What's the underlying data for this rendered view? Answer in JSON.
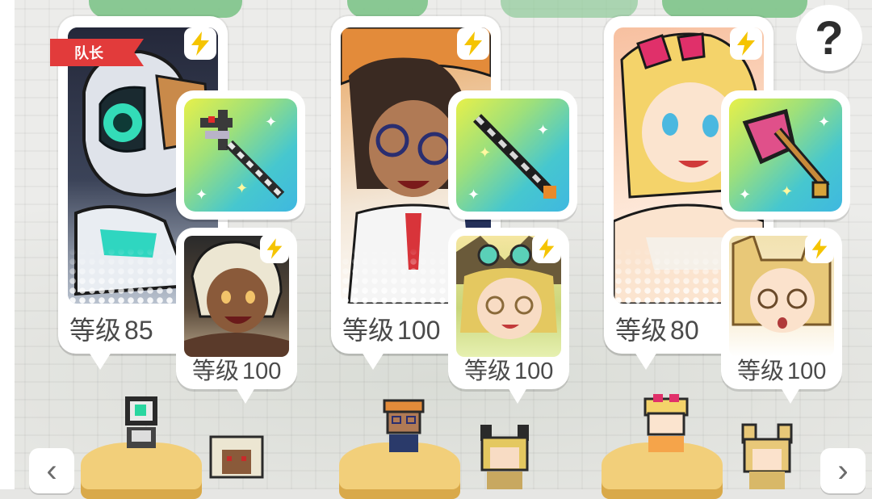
{
  "party": {
    "leader_label": "队长",
    "slots": [
      {
        "level_label": "等级",
        "level": "85",
        "support_level_label": "等级",
        "support_level": "100"
      },
      {
        "level_label": "等级",
        "level": "100",
        "support_level_label": "等级",
        "support_level": "100"
      },
      {
        "level_label": "等级",
        "level": "80",
        "support_level_label": "等级",
        "support_level": "100"
      }
    ]
  },
  "help_button": {
    "label": "?"
  },
  "nav": {
    "prev_icon": "‹",
    "next_icon": "›"
  },
  "icons": {
    "bolt": "lightning-bolt-icon",
    "help": "question-mark-icon"
  },
  "colors": {
    "leader_tag": "#e23b3b",
    "bolt": "#f5c400",
    "pedestal": "#f2cf7a"
  }
}
